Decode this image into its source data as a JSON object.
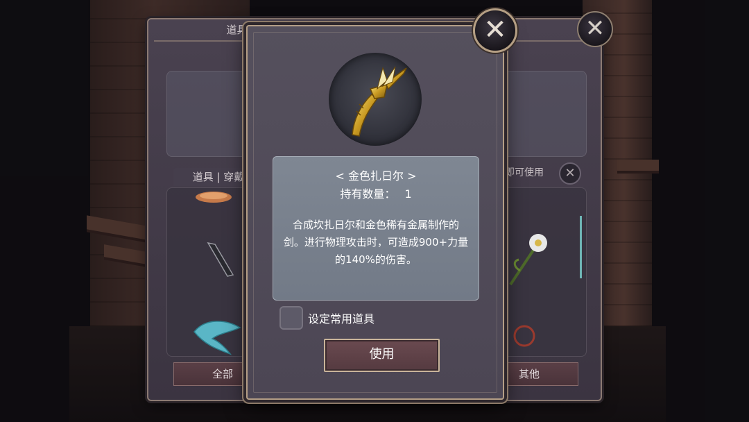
{
  "background_panel": {
    "title": "道具保管箱",
    "tab_label": "道具 | 穿戴物品",
    "hint_text": "具即可使用",
    "bottom_tabs": [
      {
        "label": "全部"
      },
      {
        "label": "其他"
      }
    ]
  },
  "item_detail": {
    "name": "< 金色扎日尔 >",
    "quantity_label": "持有数量：",
    "quantity_value": "1",
    "description": "合成坎扎日尔和金色稀有金属制作的剑。进行物理攻击时，可造成900+力量的140%的伤害。",
    "set_favorite_label": "设定常用道具",
    "use_button_label": "使用"
  },
  "icons": [
    "close-icon",
    "gold-sword-icon",
    "checkbox-icon"
  ],
  "colors": {
    "modal_border": "#b49e86",
    "desc_box": "#7f8793",
    "use_button": "#6a4a50"
  }
}
